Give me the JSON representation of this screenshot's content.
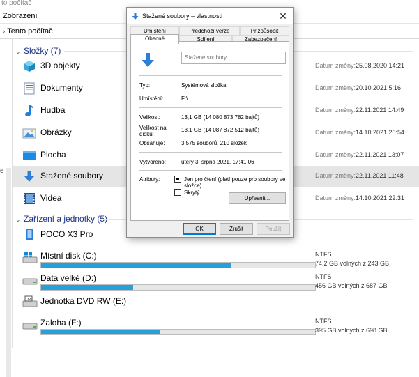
{
  "window": {
    "title_fragment": "to počítač",
    "menu_fragment": "Zobrazení",
    "breadcrumb": "Tento počítač"
  },
  "left_pane_fragments": [
    "e"
  ],
  "groups": {
    "folders": {
      "label": "Složky (7)"
    },
    "devices": {
      "label": "Zařízení a jednotky (5)"
    }
  },
  "date_label": "Datum změny:",
  "folders": [
    {
      "name": "3D objekty",
      "date": "25.08.2020 14:21",
      "icon": "3d-objects-icon"
    },
    {
      "name": "Dokumenty",
      "date": "20.10.2021 5:16",
      "icon": "documents-icon"
    },
    {
      "name": "Hudba",
      "date": "22.11.2021 14:49",
      "icon": "music-icon"
    },
    {
      "name": "Obrázky",
      "date": "14.10.2021 20:54",
      "icon": "pictures-icon"
    },
    {
      "name": "Plocha",
      "date": "22.11.2021 13:07",
      "icon": "desktop-icon"
    },
    {
      "name": "Stažené soubory",
      "date": "22.11.2021 11:48",
      "icon": "downloads-icon"
    },
    {
      "name": "Videa",
      "date": "14.10.2021 22:31",
      "icon": "videos-icon"
    }
  ],
  "devices": [
    {
      "name": "POCO X3 Pro",
      "icon": "phone-icon"
    },
    {
      "name": "Místní disk (C:)",
      "fs": "NTFS",
      "free": "74,2 GB volných z 243 GB",
      "used_fraction": 0.695,
      "icon": "windows-drive-icon"
    },
    {
      "name": "Data velké (D:)",
      "fs": "NTFS",
      "free": "456 GB volných z 687 GB",
      "used_fraction": 0.336,
      "icon": "drive-icon"
    },
    {
      "name": "Jednotka DVD RW (E:)",
      "icon": "dvd-drive-icon"
    },
    {
      "name": "Zaloha (F:)",
      "fs": "NTFS",
      "free": "395 GB volných z 698 GB",
      "used_fraction": 0.434,
      "icon": "drive-icon"
    }
  ],
  "dialog": {
    "title": "Stažené soubory – vlastnosti",
    "tabs_row1": [
      "Umístění",
      "Předchozí verze",
      "Přizpůsobit"
    ],
    "tabs_row2": [
      "Obecné",
      "Sdílení",
      "Zabezpečení"
    ],
    "active_tab": "Obecné",
    "name_value": "Stažené soubory",
    "props": {
      "type_label": "Typ:",
      "type_value": "Systémová složka",
      "location_label": "Umístění:",
      "location_value": "F:\\",
      "size_label": "Velikost:",
      "size_value": "13,1 GB (14 080 873 782 bajtů)",
      "disk_size_label_1": "Velikost na",
      "disk_size_label_2": "disku:",
      "disk_size_value": "13,1 GB (14 087 872 512 bajtů)",
      "contains_label": "Obsahuje:",
      "contains_value": "3 575 souborů, 210 složek",
      "created_label": "Vytvořeno:",
      "created_value": "úterý 3. srpna 2021, 17:41:06",
      "attributes_label": "Atributy:",
      "readonly_label": "Jen pro čtení (platí pouze pro soubory ve složce)",
      "hidden_label": "Skrytý",
      "advanced_button": "Upřesnit..."
    },
    "buttons": {
      "ok": "OK",
      "cancel": "Zrušit",
      "apply": "Použít"
    }
  }
}
